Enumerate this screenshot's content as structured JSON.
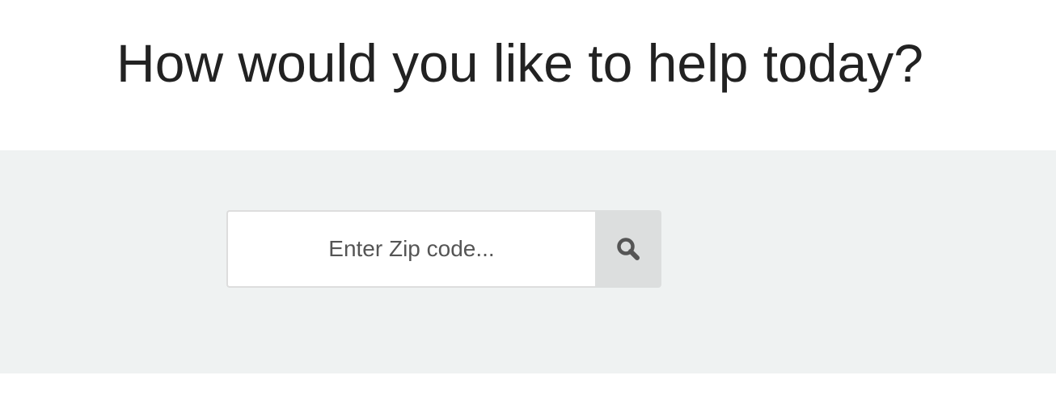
{
  "page": {
    "title": "How would you like to help today?"
  },
  "search": {
    "placeholder": "Enter Zip code...",
    "value": "",
    "icon": "search-icon"
  },
  "colors": {
    "title_text": "#222222",
    "band_background": "#eff2f2",
    "button_background": "#dcdede",
    "icon_color": "#555555"
  }
}
